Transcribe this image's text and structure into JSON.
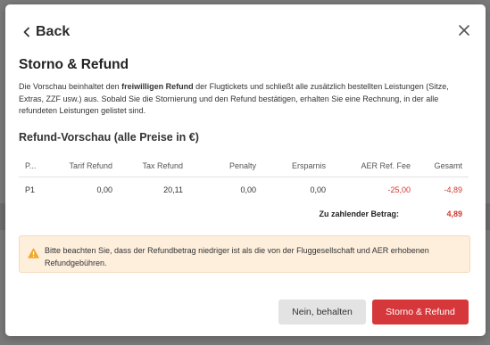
{
  "dialog": {
    "back_label": "Back",
    "title": "Storno & Refund",
    "description": {
      "part1": "Die Vorschau beinhaltet den ",
      "bold": "freiwilligen Refund",
      "part2": " der Flugtickets und schließt alle zusätzlich bestellten Leistungen (Sitze, Extras, ZZF usw.) aus. Sobald Sie die Stornierung und den Refund bestätigen, erhalten Sie eine Rechnung, in der alle refundeten Leistungen gelistet sind."
    },
    "preview_title": "Refund-Vorschau (alle Preise in €)",
    "table": {
      "headers": [
        "P...",
        "Tarif Refund",
        "Tax Refund",
        "Penalty",
        "Ersparnis",
        "AER Ref. Fee",
        "Gesamt"
      ],
      "rows": [
        [
          "P1",
          "0,00",
          "20,11",
          "0,00",
          "0,00",
          "-25,00",
          "-4,89"
        ]
      ],
      "total_label": "Zu zahlender Betrag:",
      "total_value": "4,89"
    },
    "notice": "Bitte beachten Sie, dass der Refundbetrag niedriger ist als die von der Fluggesellschaft und AER erhobenen Refundgebühren.",
    "buttons": {
      "keep": "Nein, behalten",
      "confirm": "Storno & Refund"
    }
  },
  "colors": {
    "accent": "#d6373a",
    "negative": "#d0392f",
    "notice_bg": "#fdefdc",
    "warning_icon": "#f0a830"
  }
}
